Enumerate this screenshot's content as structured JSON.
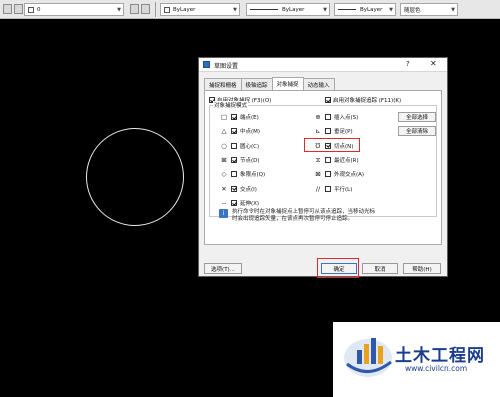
{
  "toolbar": {
    "layer_value": "0",
    "linetype_bylayer_1": "ByLayer",
    "linetype_bylayer_2": "ByLayer",
    "lineweight_bylayer": "ByLayer",
    "color_value": "随层色"
  },
  "dialog": {
    "title": "草图设置",
    "help_glyph": "?",
    "close_glyph": "✕",
    "tabs": [
      "捕捉和栅格",
      "极轴追踪",
      "对象捕捉",
      "动态输入"
    ],
    "active_tab_index": 2,
    "enable_osnap": {
      "label": "启用对象捕捉 (F3)(O)",
      "checked": true
    },
    "enable_tracking": {
      "label": "启用对象捕捉追踪 (F11)(K)",
      "checked": true
    },
    "modes_legend": "对象捕捉模式",
    "modes_left": [
      {
        "symbol": "□",
        "label": "端点(E)",
        "checked": true
      },
      {
        "symbol": "△",
        "label": "中点(M)",
        "checked": true
      },
      {
        "symbol": "○",
        "label": "圆心(C)",
        "checked": false
      },
      {
        "symbol": "⊠",
        "label": "节点(D)",
        "checked": true
      },
      {
        "symbol": "◇",
        "label": "象限点(Q)",
        "checked": false
      },
      {
        "symbol": "✕",
        "label": "交点(I)",
        "checked": true
      },
      {
        "symbol": "--",
        "label": "延伸(X)",
        "checked": true
      }
    ],
    "modes_right": [
      {
        "symbol": "⊕",
        "label": "插入点(S)",
        "checked": false
      },
      {
        "symbol": "⊾",
        "label": "垂足(P)",
        "checked": false
      },
      {
        "symbol": "℧",
        "label": "切点(N)",
        "checked": true
      },
      {
        "symbol": "⧖",
        "label": "最近点(R)",
        "checked": false
      },
      {
        "symbol": "⊠",
        "label": "外观交点(A)",
        "checked": false
      },
      {
        "symbol": "//",
        "label": "平行(L)",
        "checked": false
      }
    ],
    "select_all_label": "全部选择",
    "clear_all_label": "全部清除",
    "hint_icon": "i",
    "hint_text": "执行命令时在对象捕捉点上暂停可从该点追踪，当移动光标时会出现追踪矢量，在该点再次暂停可停止追踪。",
    "options_label": "选项(T)...",
    "ok_label": "确定",
    "cancel_label": "取消",
    "help_label": "帮助(H)",
    "highlight_color": "#e0292d"
  },
  "watermark": {
    "title": "土木工程网",
    "url": "www.civilcn.com"
  }
}
